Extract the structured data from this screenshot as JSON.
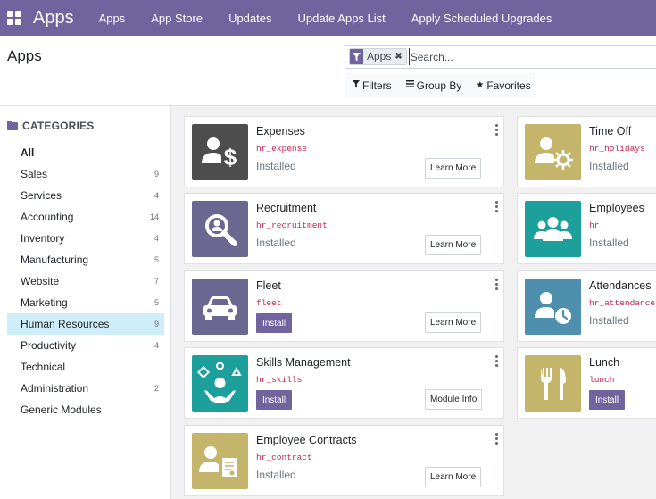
{
  "navbar": {
    "brand": "Apps",
    "items": [
      "Apps",
      "App Store",
      "Updates",
      "Update Apps List",
      "Apply Scheduled Upgrades"
    ]
  },
  "control": {
    "title": "Apps",
    "facet": "Apps",
    "search_placeholder": "Search...",
    "filters": "Filters",
    "group_by": "Group By",
    "favorites": "Favorites"
  },
  "sidebar": {
    "header": "CATEGORIES",
    "items": [
      {
        "label": "All",
        "count": ""
      },
      {
        "label": "Sales",
        "count": "9"
      },
      {
        "label": "Services",
        "count": "4"
      },
      {
        "label": "Accounting",
        "count": "14"
      },
      {
        "label": "Inventory",
        "count": "4"
      },
      {
        "label": "Manufacturing",
        "count": "5"
      },
      {
        "label": "Website",
        "count": "7"
      },
      {
        "label": "Marketing",
        "count": "5"
      },
      {
        "label": "Human Resources",
        "count": "9"
      },
      {
        "label": "Productivity",
        "count": "4"
      },
      {
        "label": "Technical",
        "count": ""
      },
      {
        "label": "Administration",
        "count": "2"
      },
      {
        "label": "Generic Modules",
        "count": ""
      }
    ],
    "active": "Human Resources"
  },
  "apps": [
    {
      "title": "Expenses",
      "tech": "hr_expense",
      "status": "Installed",
      "install": "",
      "more": "Learn More",
      "icon": "expense-icon",
      "color": "#4d4d4d"
    },
    {
      "title": "Time Off",
      "tech": "hr_holidays",
      "status": "Installed",
      "install": "",
      "more": "",
      "icon": "time-off-icon",
      "color": "#c4b56a"
    },
    {
      "title": "Recruitment",
      "tech": "hr_recruitment",
      "status": "Installed",
      "install": "",
      "more": "Learn More",
      "icon": "recruitment-icon",
      "color": "#6a6890"
    },
    {
      "title": "Employees",
      "tech": "hr",
      "status": "Installed",
      "install": "",
      "more": "",
      "icon": "employees-icon",
      "color": "#1d9f9c"
    },
    {
      "title": "Fleet",
      "tech": "fleet",
      "status": "",
      "install": "Install",
      "more": "Learn More",
      "icon": "fleet-icon",
      "color": "#6a6890"
    },
    {
      "title": "Attendances",
      "tech": "hr_attendance",
      "status": "Installed",
      "install": "",
      "more": "",
      "icon": "attendances-icon",
      "color": "#4d8fac"
    },
    {
      "title": "Skills Management",
      "tech": "hr_skills",
      "status": "",
      "install": "Install",
      "more": "Module Info",
      "icon": "skills-icon",
      "color": "#1d9f9c"
    },
    {
      "title": "Lunch",
      "tech": "lunch",
      "status": "",
      "install": "Install",
      "more": "",
      "icon": "lunch-icon",
      "color": "#c4b56a"
    },
    {
      "title": "Employee Contracts",
      "tech": "hr_contract",
      "status": "Installed",
      "install": "",
      "more": "Learn More",
      "icon": "contracts-icon",
      "color": "#c4b56a"
    }
  ]
}
